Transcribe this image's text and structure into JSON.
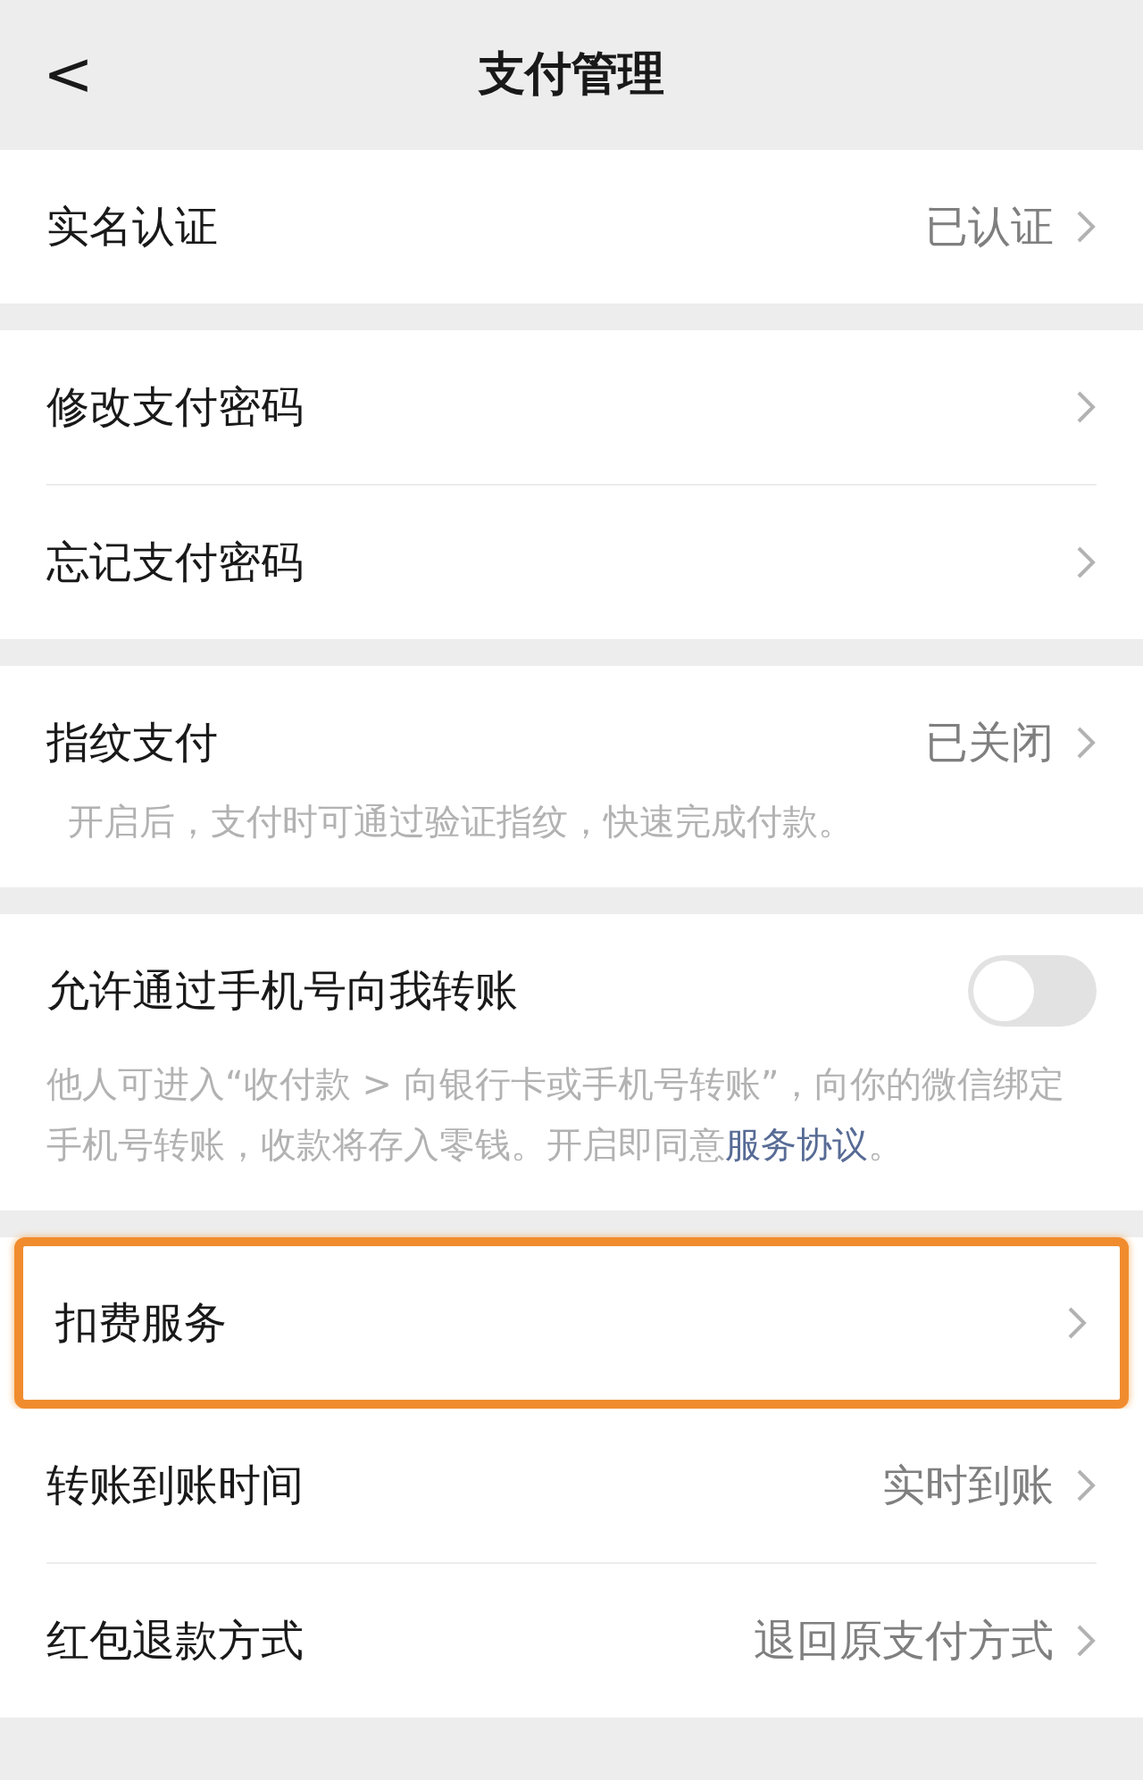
{
  "nav_bar": {
    "back": "<",
    "title": "支付管理"
  },
  "sections": [
    {
      "rows": [
        {
          "kind": "link",
          "label": "实名认证",
          "value": "已认证",
          "highlighted": false
        }
      ]
    },
    {
      "rows": [
        {
          "kind": "link",
          "label": "修改支付密码",
          "highlighted": false
        },
        {
          "kind": "link",
          "label": "忘记支付密码",
          "highlighted": false
        }
      ]
    },
    {
      "rows": [
        {
          "kind": "link",
          "label": "指纹支付",
          "value": "已关闭",
          "hint": "开启后，支付时可通过验证指纹，快速完成付款。",
          "highlighted": false
        }
      ]
    },
    {
      "rows": [
        {
          "kind": "toggle",
          "label": "允许通过手机号向我转账",
          "on": false,
          "hint": "他人可进入“收付款 > 向银行卡或手机号转账”，向你的微信绑定手机号转账，收款将存入零钱。开启即同意",
          "link": "服务协议",
          "hint_end": "。"
        }
      ]
    },
    {
      "rows": [
        {
          "kind": "link",
          "label": "扣费服务",
          "highlighted": true
        },
        {
          "kind": "link",
          "label": "转账到账时间",
          "value": "实时到账",
          "highlighted": false
        },
        {
          "kind": "link",
          "label": "红包退款方式",
          "value": "退回原支付方式",
          "highlighted": false
        }
      ]
    }
  ]
}
